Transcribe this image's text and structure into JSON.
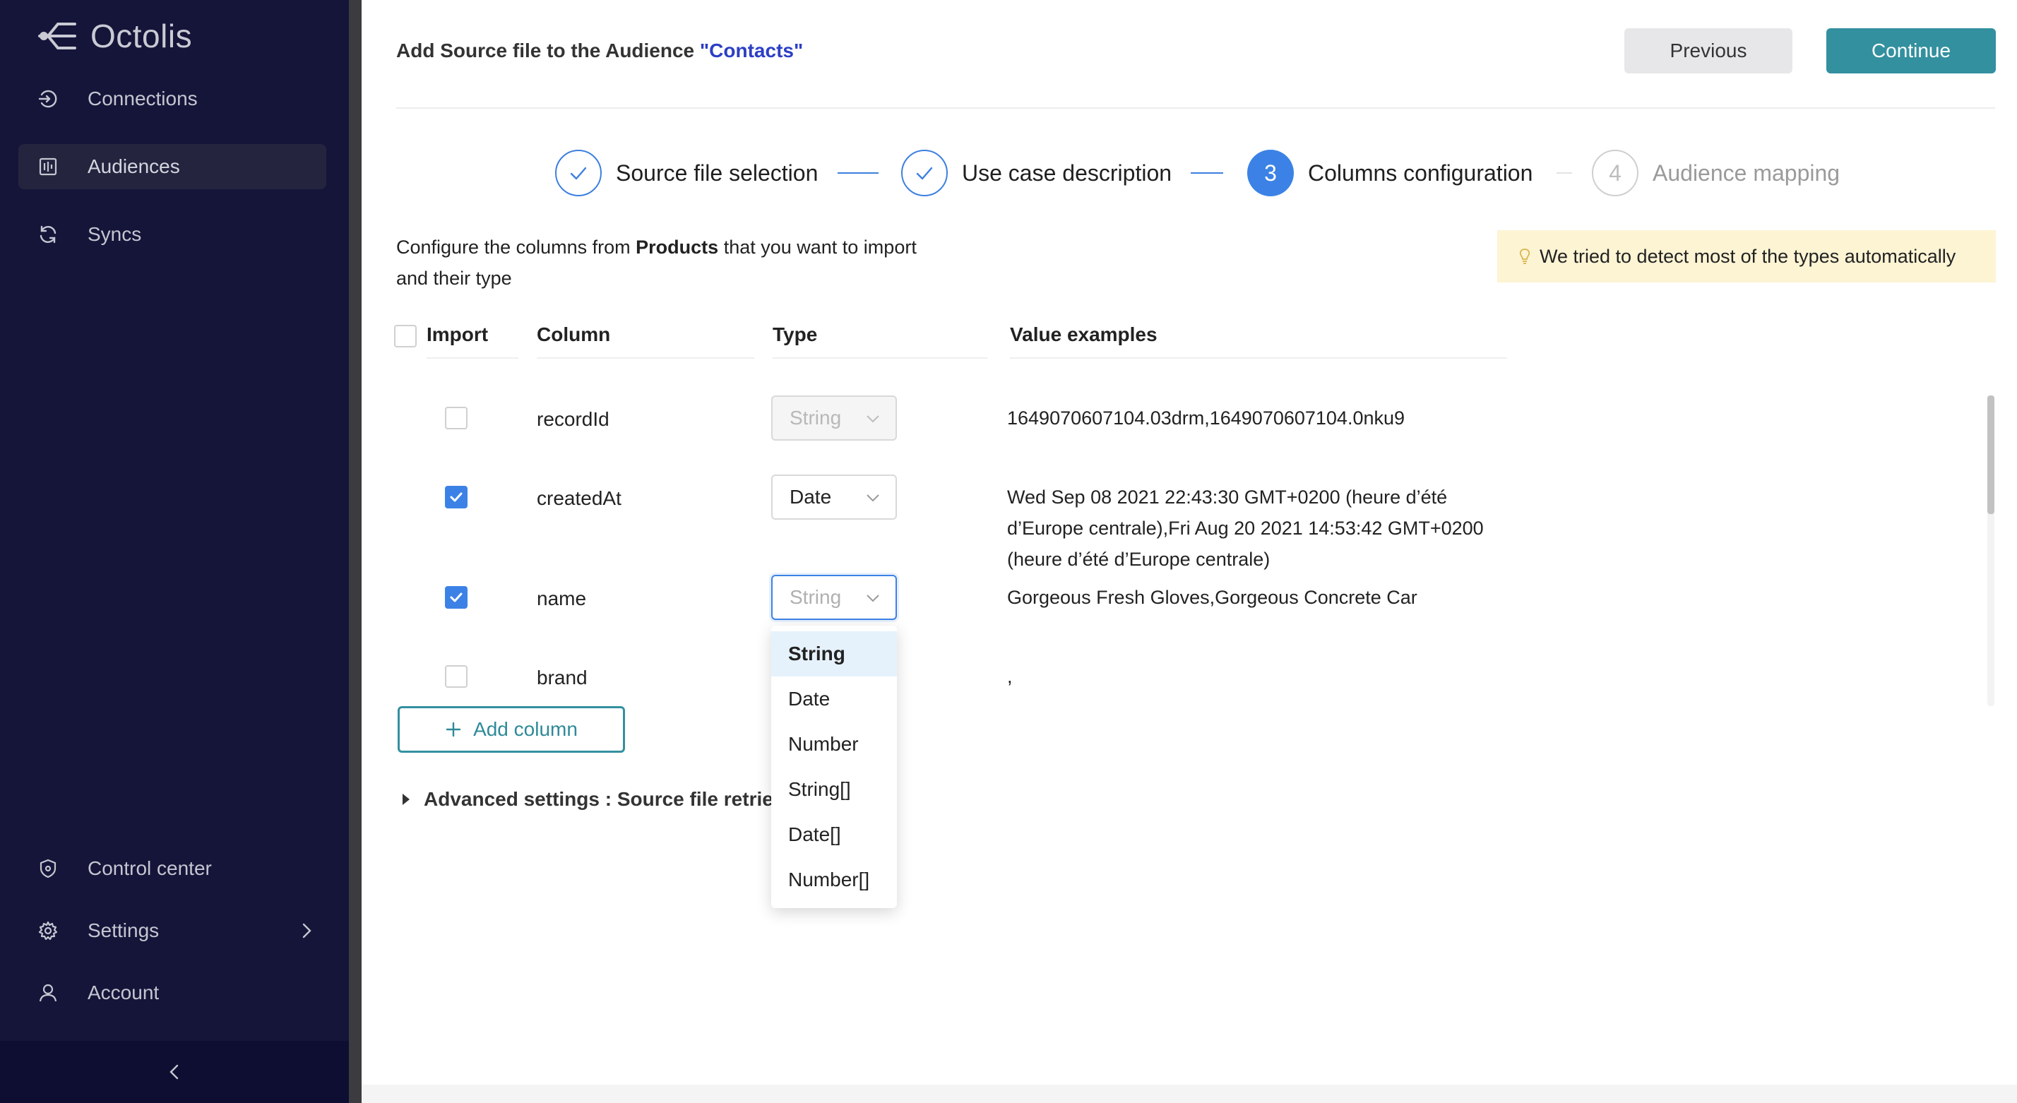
{
  "brand": {
    "name": "Octolis"
  },
  "sidebar": {
    "items": [
      {
        "label": "Connections",
        "icon": "login-arrow-icon"
      },
      {
        "label": "Audiences",
        "icon": "audiences-icon"
      },
      {
        "label": "Syncs",
        "icon": "sync-icon"
      }
    ],
    "bottom_items": [
      {
        "label": "Control center",
        "icon": "shield-icon"
      },
      {
        "label": "Settings",
        "icon": "gear-icon"
      },
      {
        "label": "Account",
        "icon": "user-icon"
      }
    ]
  },
  "header": {
    "title_prefix": "Add Source file to the Audience ",
    "audience_name": "\"Contacts\"",
    "previous_label": "Previous",
    "continue_label": "Continue"
  },
  "steps": [
    {
      "label": "Source file selection",
      "status": "done"
    },
    {
      "label": "Use case description",
      "status": "done"
    },
    {
      "number": "3",
      "label": "Columns configuration",
      "status": "current"
    },
    {
      "number": "4",
      "label": "Audience mapping",
      "status": "todo"
    }
  ],
  "intro": {
    "before": "Configure the columns from ",
    "source": "Products",
    "after": " that you want to import and their type"
  },
  "hint": {
    "text": "We tried to detect most of the types automatically"
  },
  "table": {
    "headers": {
      "import": "Import",
      "column": "Column",
      "type": "Type",
      "values": "Value examples"
    },
    "rows": [
      {
        "checked": false,
        "column": "recordId",
        "type": "String",
        "values": "1649070607104.03drm,1649070607104.0nku9"
      },
      {
        "checked": true,
        "column": "createdAt",
        "type": "Date",
        "values": "Wed Sep 08 2021 22:43:30 GMT+0200 (heure d’été d’Europe centrale),Fri Aug 20 2021 14:53:42 GMT+0200 (heure d’été d’Europe centrale)"
      },
      {
        "checked": true,
        "column": "name",
        "type": "String",
        "values": "Gorgeous Fresh Gloves,Gorgeous Concrete Car"
      },
      {
        "checked": false,
        "column": "brand",
        "type": "",
        "values": ","
      }
    ]
  },
  "type_options": [
    "String",
    "Date",
    "Number",
    "String[]",
    "Date[]",
    "Number[]"
  ],
  "add_column_label": "Add column",
  "advanced_label": "Advanced settings : Source file retrie",
  "colors": {
    "sidebar": "#15153a",
    "accent": "#33909f",
    "step_blue": "#3c82e6",
    "hint_bg": "#fdf4d4"
  }
}
